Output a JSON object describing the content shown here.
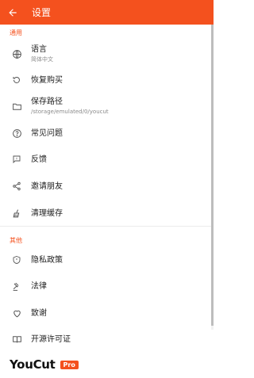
{
  "appbar": {
    "title": "设置"
  },
  "sections": {
    "general": "通用",
    "other": "其他"
  },
  "items": {
    "language": {
      "label": "语言",
      "sub": "简体中文"
    },
    "restore": {
      "label": "恢复购买"
    },
    "save_path": {
      "label": "保存路径",
      "sub": "/storage/emulated/0/youcut"
    },
    "faq": {
      "label": "常见问题"
    },
    "feedback": {
      "label": "反馈"
    },
    "invite": {
      "label": "邀请朋友"
    },
    "clear_cache": {
      "label": "清理缓存"
    },
    "privacy": {
      "label": "隐私政策"
    },
    "legal": {
      "label": "法律"
    },
    "thanks": {
      "label": "致谢"
    },
    "licenses": {
      "label": "开源许可证"
    }
  },
  "footer": {
    "logo": "YouCut",
    "badge": "Pro"
  },
  "colors": {
    "accent": "#f4511e",
    "icon": "#555555"
  }
}
